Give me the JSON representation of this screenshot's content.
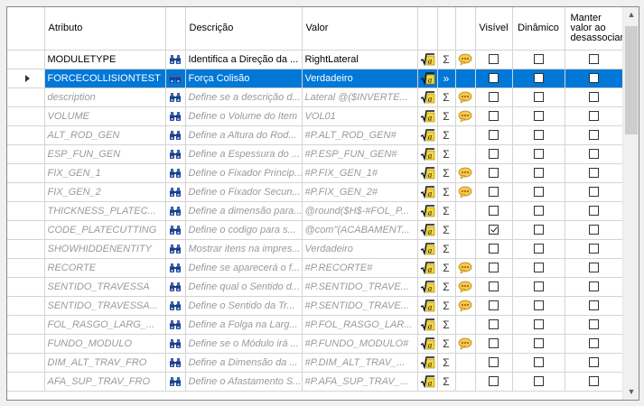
{
  "headers": {
    "atributo": "Atributo",
    "descricao": "Descrição",
    "valor": "Valor",
    "visivel": "Visível",
    "dinamico": "Dinâmico",
    "manter": "Manter valor ao desassociar"
  },
  "rows": [
    {
      "attr": "MODULETYPE",
      "desc": "Identifica a Direção da ...",
      "val": "RightLateral",
      "gray": false,
      "selected": false,
      "bubble": true,
      "visivel": false
    },
    {
      "attr": "FORCECOLLISIONTEST",
      "desc": "Força Colisão",
      "val": "Verdadeiro",
      "gray": false,
      "selected": true,
      "bubble": false,
      "visivel": false
    },
    {
      "attr": "description",
      "desc": "Define se a descrição d...",
      "val": "Lateral @($INVERTE...",
      "gray": true,
      "selected": false,
      "bubble": true,
      "visivel": false
    },
    {
      "attr": "VOLUME",
      "desc": "Define o Volume do Item",
      "val": "VOL01",
      "gray": true,
      "selected": false,
      "bubble": true,
      "visivel": false
    },
    {
      "attr": "ALT_ROD_GEN",
      "desc": "Define a Altura do Rod...",
      "val": "#P.ALT_ROD_GEN#",
      "gray": true,
      "selected": false,
      "bubble": false,
      "visivel": false
    },
    {
      "attr": "ESP_FUN_GEN",
      "desc": "Define a Espessura do ...",
      "val": "#P.ESP_FUN_GEN#",
      "gray": true,
      "selected": false,
      "bubble": false,
      "visivel": false
    },
    {
      "attr": "FIX_GEN_1",
      "desc": "Define o Fixador Princip...",
      "val": "#P.FIX_GEN_1#",
      "gray": true,
      "selected": false,
      "bubble": true,
      "visivel": false
    },
    {
      "attr": "FIX_GEN_2",
      "desc": "Define o Fixador Secun...",
      "val": "#P.FIX_GEN_2#",
      "gray": true,
      "selected": false,
      "bubble": true,
      "visivel": false
    },
    {
      "attr": "THICKNESS_PLATEC...",
      "desc": "Define a dimensão para...",
      "val": "@round($H$-#FOL_P...",
      "gray": true,
      "selected": false,
      "bubble": false,
      "visivel": false
    },
    {
      "attr": "CODE_PLATECUTTING",
      "desc": "Define o codigo para s...",
      "val": "@com\"(ACABAMENT...",
      "gray": true,
      "selected": false,
      "bubble": false,
      "visivel": true
    },
    {
      "attr": "SHOWHIDDENENTITY",
      "desc": "Mostrar itens na impres...",
      "val": "Verdadeiro",
      "gray": true,
      "selected": false,
      "bubble": false,
      "visivel": false
    },
    {
      "attr": "RECORTE",
      "desc": "Define se aparecerá o f...",
      "val": "#P.RECORTE#",
      "gray": true,
      "selected": false,
      "bubble": true,
      "visivel": false
    },
    {
      "attr": "SENTIDO_TRAVESSA",
      "desc": "Define qual o Sentido d...",
      "val": "#P.SENTIDO_TRAVE...",
      "gray": true,
      "selected": false,
      "bubble": true,
      "visivel": false
    },
    {
      "attr": "SENTIDO_TRAVESSA...",
      "desc": "Define o Sentido da Tr...",
      "val": "#P.SENTIDO_TRAVE...",
      "gray": true,
      "selected": false,
      "bubble": true,
      "visivel": false
    },
    {
      "attr": "FOL_RASGO_LARG_...",
      "desc": "Define a Folga na Larg...",
      "val": "#P.FOL_RASGO_LAR...",
      "gray": true,
      "selected": false,
      "bubble": false,
      "visivel": false
    },
    {
      "attr": "FUNDO_MODULO",
      "desc": "Define se o Módulo irá ...",
      "val": "#P.FUNDO_MODULO#",
      "gray": true,
      "selected": false,
      "bubble": true,
      "visivel": false
    },
    {
      "attr": "DIM_ALT_TRAV_FRO",
      "desc": "Define a Dimensão da ...",
      "val": "#P.DIM_ALT_TRAV_...",
      "gray": true,
      "selected": false,
      "bubble": false,
      "visivel": false
    },
    {
      "attr": "AFA_SUP_TRAV_FRO",
      "desc": "Define o Afastamento S...",
      "val": "#P.AFA_SUP_TRAV_...",
      "gray": true,
      "selected": false,
      "bubble": false,
      "visivel": false
    }
  ],
  "icons": {
    "binoculars": "binoculars-icon",
    "formula": "formula-sqrt-icon",
    "sum": "sigma-icon",
    "comment": "speech-bubble-icon",
    "sigma_glyph": "Σ",
    "selected_glyph": "»"
  }
}
